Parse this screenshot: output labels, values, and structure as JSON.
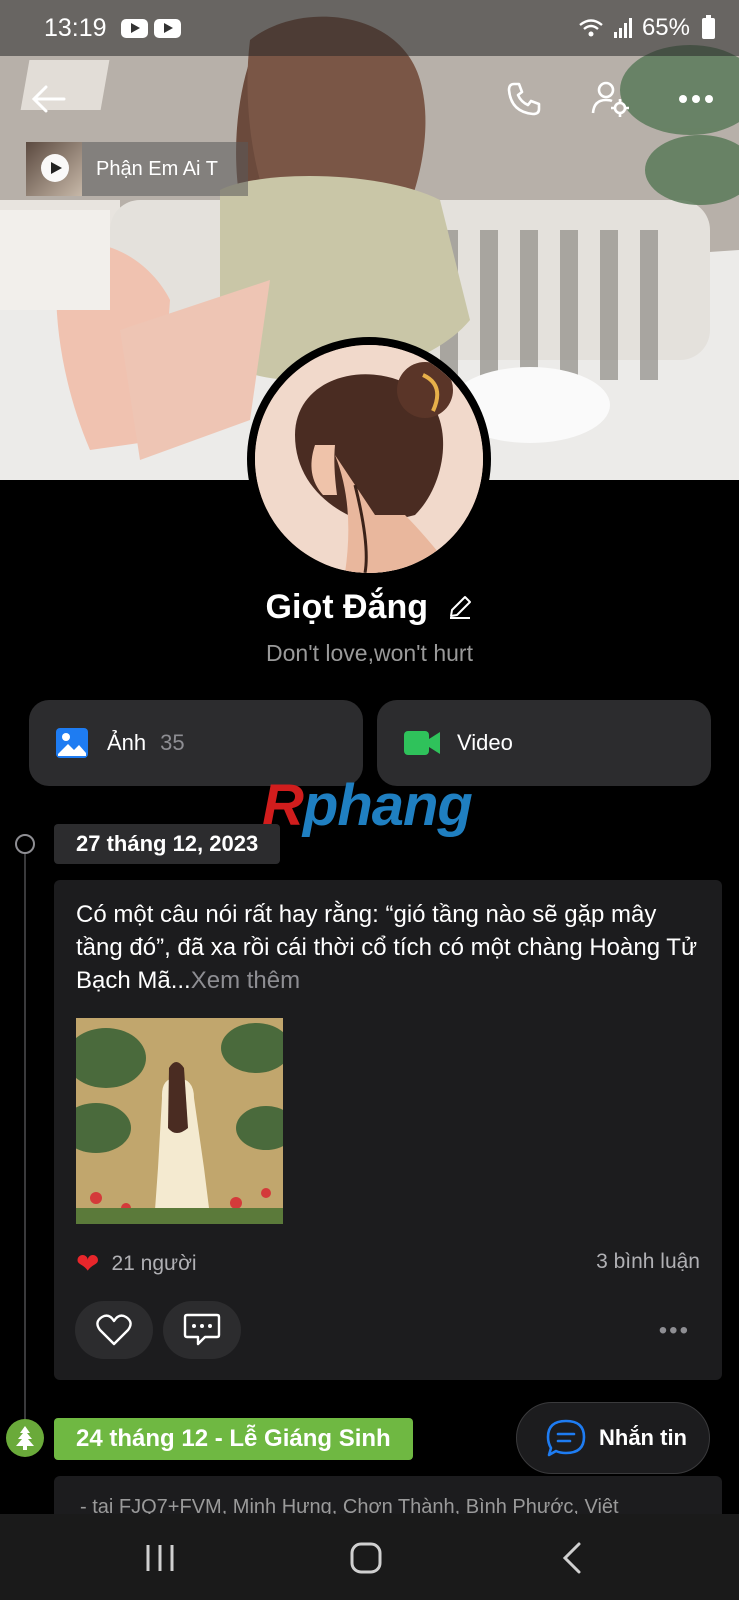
{
  "status_bar": {
    "time": "13:19",
    "battery": "65%"
  },
  "music": {
    "title": "Phận Em Ai T"
  },
  "profile": {
    "name": "Giọt Đắng",
    "bio": "Don't love,won't hurt"
  },
  "media": {
    "photos_label": "Ảnh",
    "photos_count": "35",
    "video_label": "Video"
  },
  "watermark": {
    "r": "R",
    "rest": "phang"
  },
  "timeline": {
    "date": "27 tháng 12, 2023",
    "post": {
      "text": "Có một câu nói rất hay rằng: “gió tầng nào sẽ gặp mây tầng đó”, đã xa rồi cái thời cổ tích có một chàng Hoàng Tử Bạch Mã...",
      "more": "Xem thêm",
      "likes": "21 người",
      "comments": "3 bình luận"
    },
    "next_date": "24 tháng 12 - Lễ Giáng Sinh",
    "next_location": "- tại FJQ7+FVM, Minh Hưng, Chơn Thành, Bình Phước, Việt"
  },
  "message_button": "Nhắn tin",
  "icons": {
    "back": "back-arrow-icon",
    "call": "phone-icon",
    "settings": "user-settings-icon",
    "more": "more-dots-icon",
    "photo": "image-icon",
    "video": "video-camera-icon",
    "heart": "heart-icon",
    "comment": "comment-icon",
    "tree": "christmas-tree-icon",
    "message": "chat-bubble-icon"
  },
  "colors": {
    "photo_icon": "#1e7cf2",
    "video_icon": "#2fc25b",
    "xmas": "#6fb842",
    "heart": "#e8262b"
  }
}
